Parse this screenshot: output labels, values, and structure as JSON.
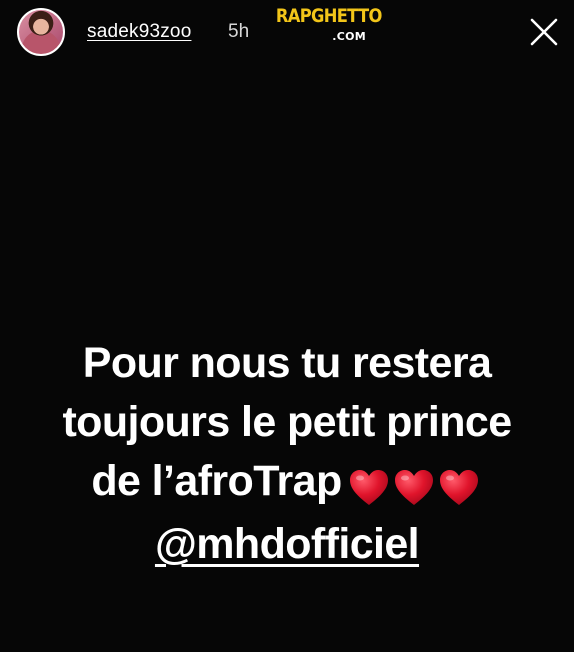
{
  "header": {
    "username": "sadek93zoo",
    "timestamp": "5h",
    "close_icon": "close-icon"
  },
  "watermark": {
    "main": "RAPGHETTO",
    "sub": ".COM"
  },
  "caption": {
    "line1": "Pour nous tu restera",
    "line2": "toujours le petit prince",
    "line3": "de l’afroTrap",
    "emoji": [
      "red-heart-icon",
      "red-heart-icon",
      "red-heart-icon"
    ],
    "mention": "@mhdofficiel"
  },
  "colors": {
    "background": "#060606",
    "watermark_yellow": "#f2c519",
    "heart_red": "#e0142b"
  }
}
